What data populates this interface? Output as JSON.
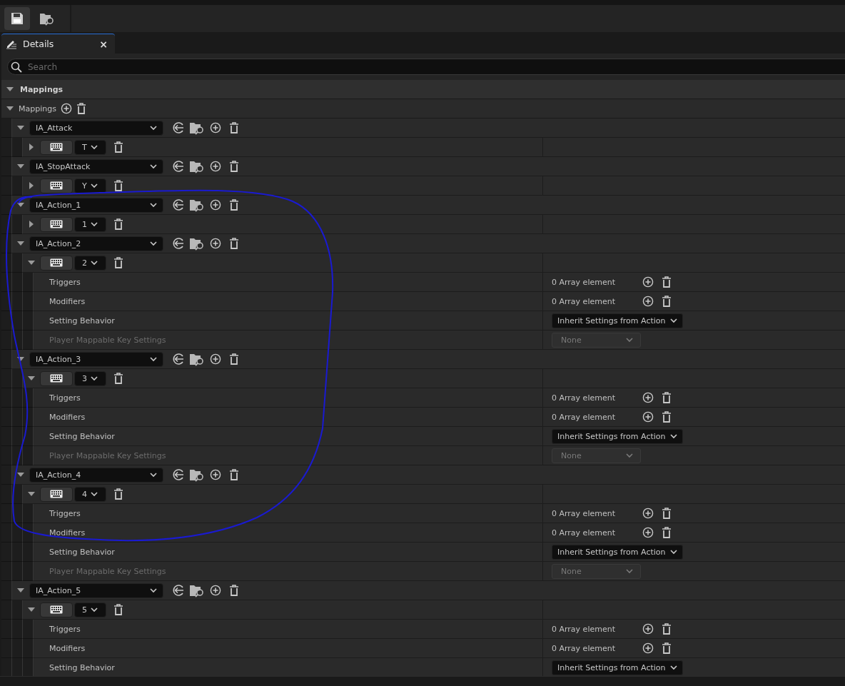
{
  "tab": {
    "title": "Details",
    "close": "×"
  },
  "search": {
    "placeholder": "Search"
  },
  "category": {
    "title": "Mappings",
    "expanded": true
  },
  "array": {
    "label": "Mappings",
    "expanded": true
  },
  "mappings": [
    {
      "action": "IA_Attack",
      "expanded": true,
      "keys": [
        {
          "key": "T",
          "expanded": false
        }
      ]
    },
    {
      "action": "IA_StopAttack",
      "expanded": true,
      "keys": [
        {
          "key": "Y",
          "expanded": false
        }
      ]
    },
    {
      "action": "IA_Action_1",
      "expanded": true,
      "keys": [
        {
          "key": "1",
          "expanded": false
        }
      ]
    },
    {
      "action": "IA_Action_2",
      "expanded": true,
      "keys": [
        {
          "key": "2",
          "expanded": true,
          "properties": [
            {
              "kind": "array",
              "label": "Triggers",
              "value": "0 Array element",
              "disabled": false
            },
            {
              "kind": "array",
              "label": "Modifiers",
              "value": "0 Array element",
              "disabled": false
            },
            {
              "kind": "dropdown",
              "label": "Setting Behavior",
              "value": "Inherit Settings from Action",
              "disabled": false
            },
            {
              "kind": "dropdown",
              "label": "Player Mappable Key Settings",
              "value": "None",
              "disabled": true
            }
          ]
        }
      ]
    },
    {
      "action": "IA_Action_3",
      "expanded": true,
      "keys": [
        {
          "key": "3",
          "expanded": true,
          "properties": [
            {
              "kind": "array",
              "label": "Triggers",
              "value": "0 Array element",
              "disabled": false
            },
            {
              "kind": "array",
              "label": "Modifiers",
              "value": "0 Array element",
              "disabled": false
            },
            {
              "kind": "dropdown",
              "label": "Setting Behavior",
              "value": "Inherit Settings from Action",
              "disabled": false
            },
            {
              "kind": "dropdown",
              "label": "Player Mappable Key Settings",
              "value": "None",
              "disabled": true
            }
          ]
        }
      ]
    },
    {
      "action": "IA_Action_4",
      "expanded": true,
      "keys": [
        {
          "key": "4",
          "expanded": true,
          "properties": [
            {
              "kind": "array",
              "label": "Triggers",
              "value": "0 Array element",
              "disabled": false
            },
            {
              "kind": "array",
              "label": "Modifiers",
              "value": "0 Array element",
              "disabled": false
            },
            {
              "kind": "dropdown",
              "label": "Setting Behavior",
              "value": "Inherit Settings from Action",
              "disabled": false
            },
            {
              "kind": "dropdown",
              "label": "Player Mappable Key Settings",
              "value": "None",
              "disabled": true
            }
          ]
        }
      ]
    },
    {
      "action": "IA_Action_5",
      "expanded": true,
      "keys": [
        {
          "key": "5",
          "expanded": true,
          "properties": [
            {
              "kind": "array",
              "label": "Triggers",
              "value": "0 Array element",
              "disabled": false
            },
            {
              "kind": "array",
              "label": "Modifiers",
              "value": "0 Array element",
              "disabled": false
            },
            {
              "kind": "dropdown",
              "label": "Setting Behavior",
              "value": "Inherit Settings from Action",
              "disabled": false
            }
          ]
        }
      ]
    }
  ]
}
